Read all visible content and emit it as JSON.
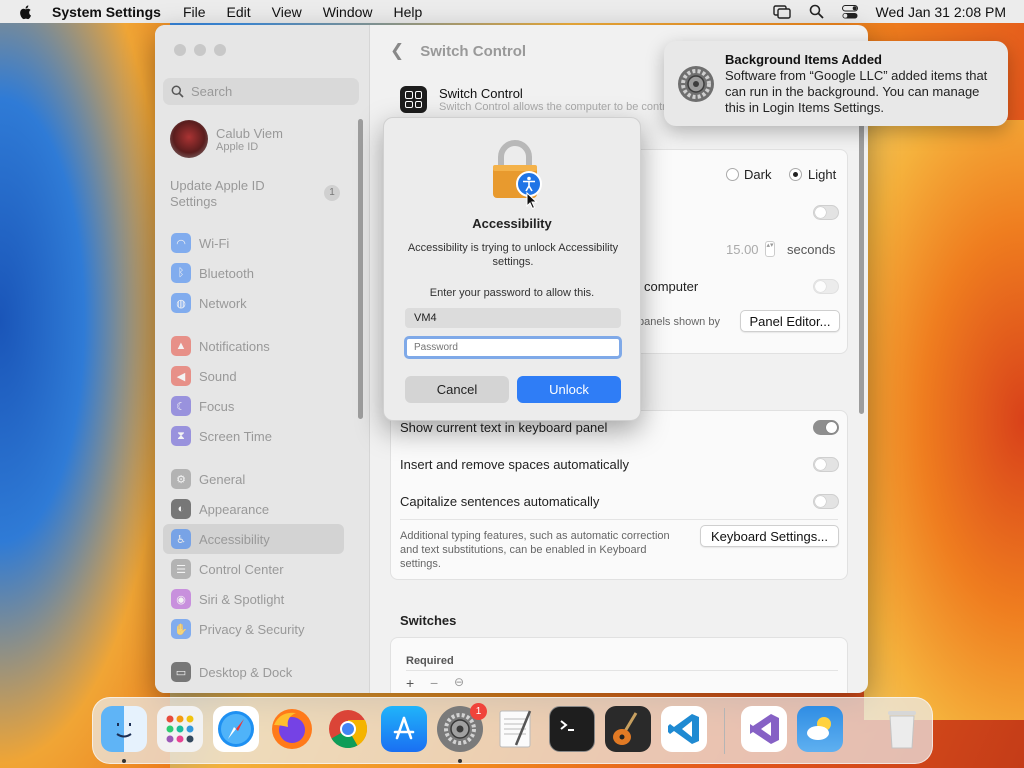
{
  "menubar": {
    "app_name": "System Settings",
    "menus": [
      "File",
      "Edit",
      "View",
      "Window",
      "Help"
    ],
    "datetime": "Wed Jan 31  2:08 PM"
  },
  "sidebar": {
    "search_placeholder": "Search",
    "profile": {
      "name": "Calub Viem",
      "subtitle": "Apple ID"
    },
    "update": {
      "label": "Update Apple ID Settings",
      "badge": "1"
    },
    "items": [
      {
        "label": "Wi-Fi",
        "icon": "wifi-icon",
        "color": "#2f7df6"
      },
      {
        "label": "Bluetooth",
        "icon": "bluetooth-icon",
        "color": "#2f7df6"
      },
      {
        "label": "Network",
        "icon": "globe-icon",
        "color": "#2f7df6"
      },
      {
        "label": "Notifications",
        "icon": "bell-icon",
        "color": "#e84a3c"
      },
      {
        "label": "Sound",
        "icon": "speaker-icon",
        "color": "#e84a3c"
      },
      {
        "label": "Focus",
        "icon": "moon-icon",
        "color": "#5b4fd6"
      },
      {
        "label": "Screen Time",
        "icon": "hourglass-icon",
        "color": "#5b4fd6"
      },
      {
        "label": "General",
        "icon": "gear-icon",
        "color": "#8a8a8a"
      },
      {
        "label": "Appearance",
        "icon": "appearance-icon",
        "color": "#1d1d1d"
      },
      {
        "label": "Accessibility",
        "icon": "accessibility-icon",
        "color": "#2f7df6"
      },
      {
        "label": "Control Center",
        "icon": "control-center-icon",
        "color": "#8a8a8a"
      },
      {
        "label": "Siri & Spotlight",
        "icon": "siri-icon",
        "color": "#b04ad6"
      },
      {
        "label": "Privacy & Security",
        "icon": "hand-icon",
        "color": "#2f7df6"
      },
      {
        "label": "Desktop & Dock",
        "icon": "dock-icon",
        "color": "#1d1d1d"
      }
    ]
  },
  "content": {
    "title": "Switch Control",
    "header": {
      "title": "Switch Control",
      "description": "Switch Control allows the computer to be controlled by keyboard, gamepad buttons"
    },
    "appearance": {
      "dark": "Dark",
      "light": "Light"
    },
    "seconds_value": "15.00",
    "seconds_unit": "seconds",
    "computer_label": "computer",
    "panels_label": "panels shown by",
    "panel_editor": "Panel Editor...",
    "rows": {
      "show_text": "Show current text in keyboard panel",
      "insert_spaces": "Insert and remove spaces automatically",
      "capitalize": "Capitalize sentences automatically"
    },
    "additional": "Additional typing features, such as automatic correction and text substitutions, can be enabled in Keyboard settings.",
    "keyboard_settings": "Keyboard Settings...",
    "switches_title": "Switches",
    "required_label": "Required"
  },
  "dialog": {
    "title": "Accessibility",
    "message": "Accessibility is trying to unlock Accessibility settings.",
    "prompt": "Enter your password to allow this.",
    "username": "VM4",
    "password_placeholder": "Password",
    "cancel": "Cancel",
    "unlock": "Unlock"
  },
  "notification": {
    "title": "Background Items Added",
    "body": "Software from “Google LLC” added items that can run in the background. You can manage this in Login Items Settings."
  },
  "dock": {
    "settings_badge": "1",
    "apps": [
      "finder-icon",
      "launchpad-icon",
      "safari-icon",
      "firefox-icon",
      "chrome-icon",
      "app-store-icon",
      "system-settings-icon",
      "textedit-icon",
      "terminal-icon",
      "garageband-icon",
      "vscode-icon",
      "visual-studio-icon",
      "weather-icon",
      "trash-icon"
    ]
  }
}
